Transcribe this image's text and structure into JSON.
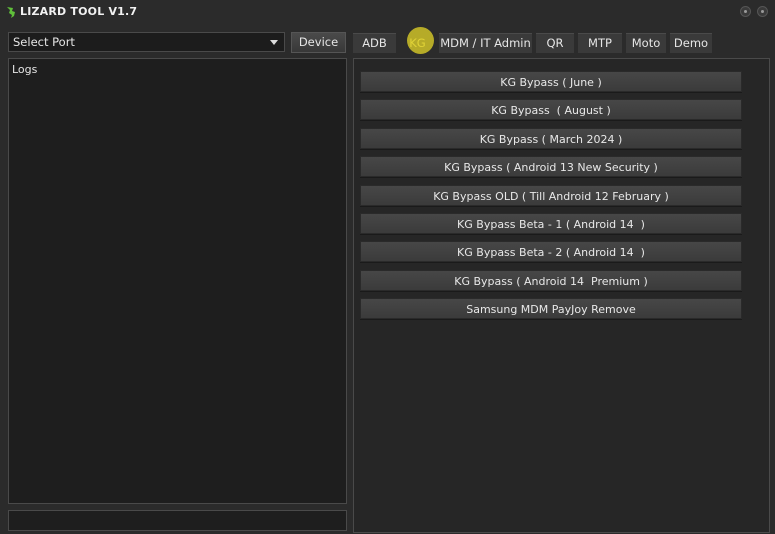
{
  "window": {
    "title": "LIZARD TOOL V1.7",
    "icon": "lizard-icon"
  },
  "port": {
    "selected": "Select Port"
  },
  "device_button": "Device",
  "logs": {
    "label": "Logs"
  },
  "tabs": [
    {
      "label": "ADB"
    },
    {
      "label": "KG",
      "active": true
    },
    {
      "label": "MDM / IT Admin"
    },
    {
      "label": "QR"
    },
    {
      "label": "MTP"
    },
    {
      "label": "Moto"
    },
    {
      "label": "Demo"
    }
  ],
  "actions": [
    {
      "label": "KG Bypass ( June )"
    },
    {
      "label": "KG Bypass  ( August )"
    },
    {
      "label": "KG Bypass ( March 2024 )"
    },
    {
      "label": "KG Bypass ( Android 13 New Security )"
    },
    {
      "label": "KG Bypass OLD ( Till Android 12 February )"
    },
    {
      "label": "KG Bypass Beta - 1 ( Android 14  )"
    },
    {
      "label": "KG Bypass Beta - 2 ( Android 14  )"
    },
    {
      "label": "KG Bypass ( Android 14  Premium )"
    },
    {
      "label": "Samsung MDM PayJoy Remove"
    }
  ],
  "colors": {
    "background": "#2b2b2b",
    "panel": "#1e1e1e",
    "highlight": "#e6d728"
  }
}
